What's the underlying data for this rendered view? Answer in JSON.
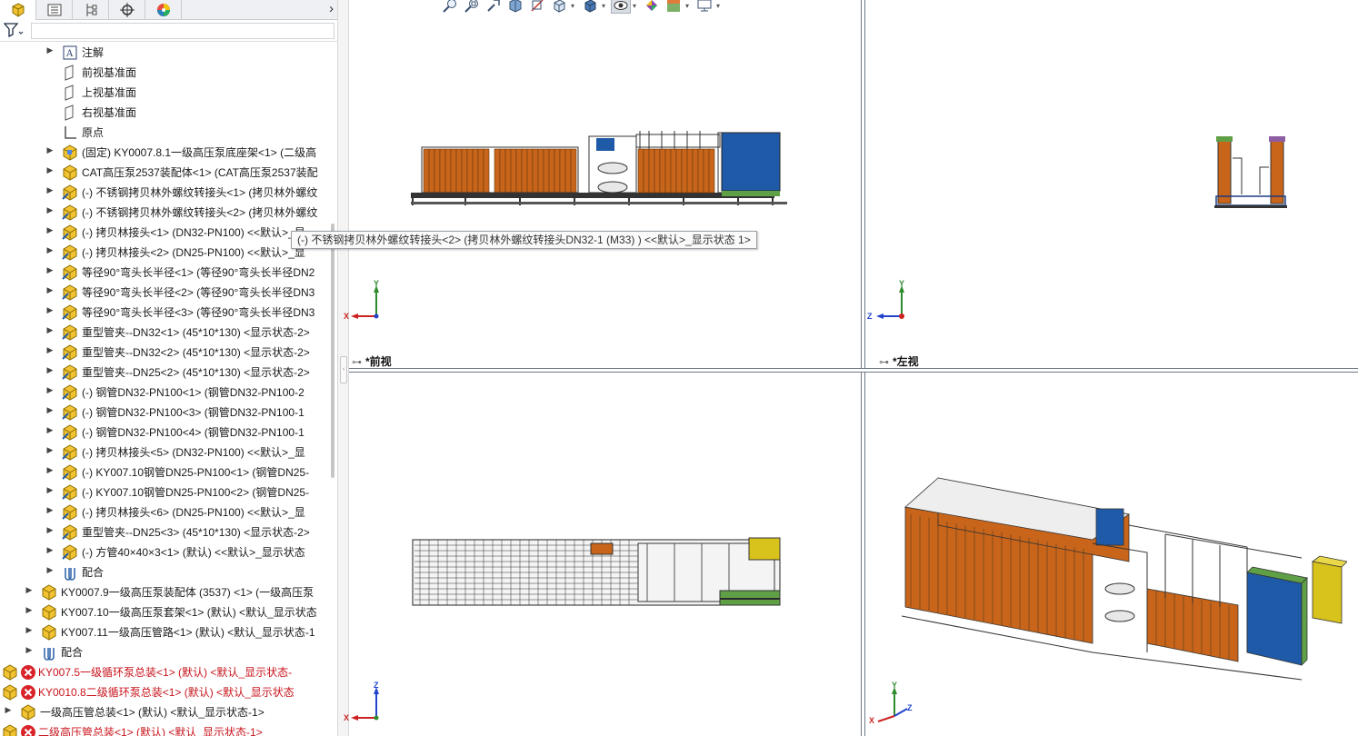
{
  "tabs": [
    {
      "icon": "feature-manager-icon",
      "active": true
    },
    {
      "icon": "property-manager-icon",
      "active": false
    },
    {
      "icon": "configuration-manager-icon",
      "active": false
    },
    {
      "icon": "dimxpert-icon",
      "active": false
    },
    {
      "icon": "display-manager-icon",
      "active": false
    }
  ],
  "tree": [
    {
      "label": "注解",
      "icon": "annotation-icon",
      "expander": "▶"
    },
    {
      "label": "前视基准面",
      "icon": "plane-icon",
      "expander": ""
    },
    {
      "label": "上视基准面",
      "icon": "plane-icon",
      "expander": ""
    },
    {
      "label": "右视基准面",
      "icon": "plane-icon",
      "expander": ""
    },
    {
      "label": "原点",
      "icon": "origin-icon",
      "expander": ""
    },
    {
      "label": "(固定) KY0007.8.1一级高压泵底座架<1> (二级高",
      "icon": "part-icon",
      "expander": "▶"
    },
    {
      "label": "CAT高压泵2537装配体<1> (CAT高压泵2537装配",
      "icon": "subassembly-icon",
      "expander": "▶"
    },
    {
      "label": "(-) 不锈钢拷贝林外螺纹转接头<1> (拷贝林外螺纹",
      "icon": "part-edit-icon",
      "expander": "▶"
    },
    {
      "label": "(-) 不锈钢拷贝林外螺纹转接头<2> (拷贝林外螺纹",
      "icon": "part-edit-icon",
      "expander": "▶"
    },
    {
      "label": "(-) 拷贝林接头<1> (DN32-PN100) <<默认>_显",
      "icon": "part-edit-icon",
      "expander": "▶"
    },
    {
      "label": "(-) 拷贝林接头<2> (DN25-PN100) <<默认>_显",
      "icon": "part-edit-icon",
      "expander": "▶"
    },
    {
      "label": "等径90°弯头长半径<1> (等径90°弯头长半径DN2",
      "icon": "part-edit-icon",
      "expander": "▶"
    },
    {
      "label": "等径90°弯头长半径<2> (等径90°弯头长半径DN3",
      "icon": "part-edit-icon",
      "expander": "▶"
    },
    {
      "label": "等径90°弯头长半径<3> (等径90°弯头长半径DN3",
      "icon": "part-edit-icon",
      "expander": "▶"
    },
    {
      "label": "重型管夹--DN32<1> (45*10*130) <显示状态-2>",
      "icon": "part-edit-icon",
      "expander": "▶"
    },
    {
      "label": "重型管夹--DN32<2> (45*10*130) <显示状态-2>",
      "icon": "part-edit-icon",
      "expander": "▶"
    },
    {
      "label": "重型管夹--DN25<2> (45*10*130) <显示状态-2>",
      "icon": "part-edit-icon",
      "expander": "▶"
    },
    {
      "label": "(-) 钢管DN32-PN100<1> (钢管DN32-PN100-2",
      "icon": "part-edit-icon",
      "expander": "▶"
    },
    {
      "label": "(-) 钢管DN32-PN100<3> (钢管DN32-PN100-1",
      "icon": "part-edit-icon",
      "expander": "▶"
    },
    {
      "label": "(-) 钢管DN32-PN100<4> (钢管DN32-PN100-1",
      "icon": "part-edit-icon",
      "expander": "▶"
    },
    {
      "label": "(-) 拷贝林接头<5> (DN32-PN100) <<默认>_显",
      "icon": "part-edit-icon",
      "expander": "▶"
    },
    {
      "label": "(-) KY007.10钢管DN25-PN100<1> (钢管DN25-",
      "icon": "part-edit-icon",
      "expander": "▶"
    },
    {
      "label": "(-) KY007.10钢管DN25-PN100<2> (钢管DN25-",
      "icon": "part-edit-icon",
      "expander": "▶"
    },
    {
      "label": "(-) 拷贝林接头<6> (DN25-PN100) <<默认>_显",
      "icon": "part-edit-icon",
      "expander": "▶"
    },
    {
      "label": "重型管夹--DN25<3> (45*10*130) <显示状态-2>",
      "icon": "part-edit-icon",
      "expander": "▶"
    },
    {
      "label": "(-) 方管40×40×3<1> (默认) <<默认>_显示状态",
      "icon": "part-edit-icon",
      "expander": "▶"
    },
    {
      "label": "配合",
      "icon": "mates-icon",
      "expander": "▶"
    },
    {
      "label": "KY0007.9一级高压泵装配体 (3537) <1> (一级高压泵",
      "icon": "subassembly-icon",
      "expander": "▶"
    },
    {
      "label": "KY007.10一级高压泵套架<1> (默认) <默认_显示状态",
      "icon": "subassembly-icon",
      "expander": "▶"
    },
    {
      "label": "KY007.11一级高压管路<1> (默认) <默认_显示状态-1",
      "icon": "subassembly-icon",
      "expander": "▶"
    },
    {
      "label": "配合",
      "icon": "mates-icon",
      "expander": "▶"
    },
    {
      "label": "KY007.5一级循环泵总装<1> (默认) <默认_显示状态-",
      "icon": "subassembly-error-icon",
      "expander": "▶"
    },
    {
      "label": "KY0010.8二级循环泵总装<1> (默认) <默认_显示状态",
      "icon": "subassembly-error-icon",
      "expander": "▶"
    },
    {
      "label": "一级高压管总装<1> (默认) <默认_显示状态-1>",
      "icon": "subassembly-icon",
      "expander": "▶"
    },
    {
      "label": "二级高压管总装<1> (默认) <默认_显示状态-1>",
      "icon": "subassembly-error-icon",
      "expander": "▶"
    }
  ],
  "tooltip": "(-) 不锈钢拷贝林外螺纹转接头<2> (拷贝林外螺纹转接头DN32-1 (M33) ) <<默认>_显示状态 1>",
  "views": {
    "front": {
      "label": "*前视"
    },
    "left": {
      "label": "*左视"
    }
  },
  "hud_buttons": [
    "zoom-to-fit-icon",
    "zoom-area-icon",
    "previous-view-icon",
    "section-view-icon",
    "dynamic-annotation-icon",
    "view-orientation-icon",
    "display-style-icon",
    "hide-show-icon",
    "edit-appearance-icon",
    "apply-scene-icon",
    "view-settings-icon"
  ],
  "colors": {
    "accent": "#1f5aa8",
    "error_text": "#c8141c",
    "frame_divider": "#6e7886",
    "tank_orange": "#c8651a",
    "panel_blue": "#1f5aa8",
    "panel_green": "#5fa046",
    "panel_yellow": "#d8c21c"
  }
}
